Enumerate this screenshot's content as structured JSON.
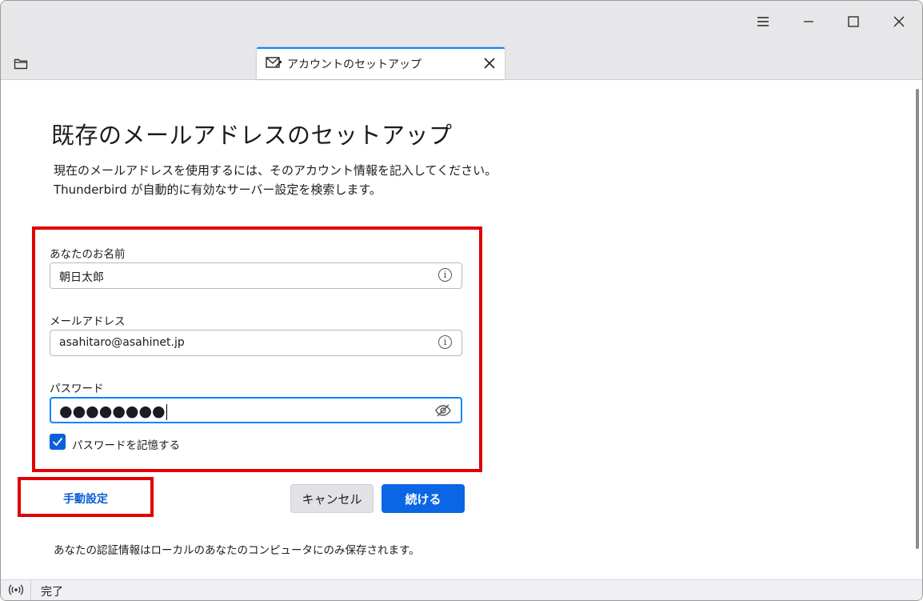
{
  "window": {
    "menu_icon": "hamburger-icon",
    "minimize_icon": "minimize-icon",
    "maximize_icon": "maximize-icon",
    "close_icon": "close-icon"
  },
  "tabs": [
    {
      "label": "アカウントのセットアップ",
      "icon": "mail-setup-icon",
      "active": true
    }
  ],
  "page": {
    "heading": "既存のメールアドレスのセットアップ",
    "description_line1": "現在のメールアドレスを使用するには、そのアカウント情報を記入してください。",
    "description_line2": "Thunderbird が自動的に有効なサーバー設定を検索します。"
  },
  "form": {
    "name": {
      "label": "あなたのお名前",
      "value": "朝日太郎",
      "icon": "info-icon"
    },
    "email": {
      "label": "メールアドレス",
      "value": "asahitaro@asahinet.jp",
      "icon": "info-icon"
    },
    "password": {
      "label": "パスワード",
      "value": "●●●●●●●●",
      "icon": "eye-slash-icon"
    },
    "remember": {
      "label": "パスワードを記憶する",
      "checked": true
    }
  },
  "buttons": {
    "manual": "手動設定",
    "cancel": "キャンセル",
    "continue": "続ける"
  },
  "footer_note": "あなたの認証情報はローカルのあなたのコンピュータにのみ保存されます。",
  "status": {
    "icon": "broadcast-icon",
    "text": "完了"
  },
  "colors": {
    "accent": "#0a66e4",
    "highlight": "#e00000",
    "checkbox": "#0a60d8"
  }
}
